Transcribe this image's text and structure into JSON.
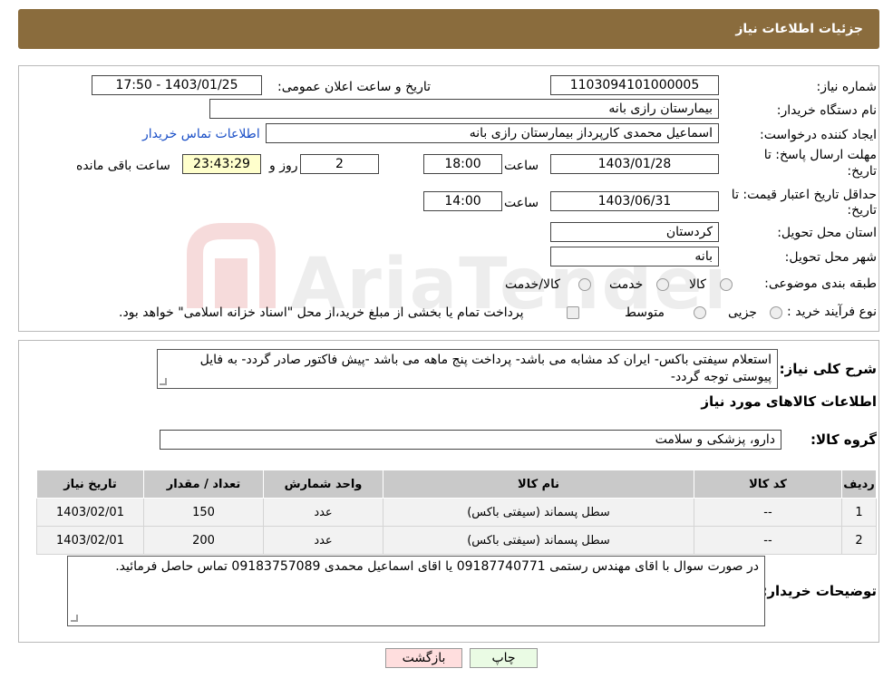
{
  "header": {
    "title": "جزئیات اطلاعات نیاز"
  },
  "need_number": {
    "label": "شماره نیاز:",
    "value": "1103094101000005"
  },
  "announce": {
    "label": "تاریخ و ساعت اعلان عمومی:",
    "value": "1403/01/25 - 17:50"
  },
  "buyer_org": {
    "label": "نام دستگاه خریدار:",
    "value": "بیمارستان رازی بانه"
  },
  "requester": {
    "label": "ایجاد کننده درخواست:",
    "value": "اسماعیل محمدی کارپرداز بیمارستان رازی بانه",
    "contact_link": "اطلاعات تماس خریدار"
  },
  "deadline": {
    "label_line1": "مهلت ارسال پاسخ: تا",
    "label_line2": "تاریخ:",
    "date": "1403/01/28",
    "time_label": "ساعت",
    "time": "18:00",
    "days": "2",
    "days_label": "روز و",
    "remaining": "23:43:29",
    "remaining_label": "ساعت باقی مانده"
  },
  "validity": {
    "label_line1": "حداقل تاریخ اعتبار قیمت: تا",
    "label_line2": "تاریخ:",
    "date": "1403/06/31",
    "time_label": "ساعت",
    "time": "14:00"
  },
  "province": {
    "label": "استان محل تحویل:",
    "value": "کردستان"
  },
  "city": {
    "label": "شهر محل تحویل:",
    "value": "بانه"
  },
  "category": {
    "label": "طبقه بندی موضوعی:",
    "options": [
      "کالا",
      "خدمت",
      "کالا/خدمت"
    ]
  },
  "purchase_type": {
    "label": "نوع فرآیند خرید :",
    "options": [
      "جزیی",
      "متوسط"
    ],
    "note": "پرداخت تمام یا بخشی از مبلغ خرید،از محل \"اسناد خزانه اسلامی\" خواهد بود."
  },
  "description": {
    "label": "شرح کلی نیاز:",
    "text": "استعلام سیفتی باکس-  ایران کد مشابه می باشد- پرداخت پنج ماهه می باشد -پیش فاکتور صادر گردد- به فایل پیوستی توجه گردد-"
  },
  "goods_info": {
    "title": "اطلاعات کالاهای مورد نیاز"
  },
  "goods_group": {
    "label": "گروه کالا:",
    "value": "دارو، پزشکی و سلامت"
  },
  "table": {
    "headers": [
      "ردیف",
      "کد کالا",
      "نام کالا",
      "واحد شمارش",
      "تعداد / مقدار",
      "تاریخ نیاز"
    ],
    "rows": [
      [
        "1",
        "--",
        "سطل پسماند (سیفتی باکس)",
        "عدد",
        "150",
        "1403/02/01"
      ],
      [
        "2",
        "--",
        "سطل پسماند (سیفتی باکس)",
        "عدد",
        "200",
        "1403/02/01"
      ]
    ]
  },
  "buyer_notes": {
    "label": "توضیحات خریدار:",
    "text": "در صورت سوال با اقای مهندس رستمی 09187740771 یا اقای اسماعیل محمدی 09183757089 تماس حاصل فرمائید."
  },
  "buttons": {
    "print": "چاپ",
    "back": "بازگشت"
  },
  "colors": {
    "header": "#8a6c3d",
    "link": "#1a4fc7",
    "back_button": "#ffdede",
    "print_button": "#eafbe4"
  }
}
